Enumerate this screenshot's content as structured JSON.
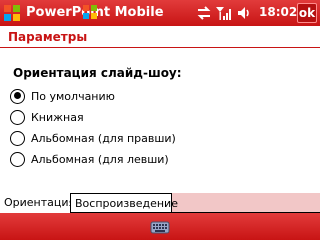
{
  "titlebar": {
    "app_title": "PowerPoint Mobile",
    "clock": "18:02",
    "ok_label": "ok",
    "icons": [
      "windows-start-icon",
      "connectivity-icon",
      "signal-icon",
      "speaker-icon"
    ]
  },
  "header": {
    "title": "Параметры"
  },
  "orientation": {
    "group_label": "Ориентация слайд-шоу:",
    "options": [
      {
        "label": "По умолчанию",
        "checked": true
      },
      {
        "label": "Книжная",
        "checked": false
      },
      {
        "label": "Альбомная (для правши)",
        "checked": false
      },
      {
        "label": "Альбомная (для левши)",
        "checked": false
      }
    ]
  },
  "tabs": [
    {
      "label": "Ориентация",
      "active": true
    },
    {
      "label": "Воспроизведение",
      "active": false
    }
  ],
  "bottombar": {
    "icon": "keyboard-icon"
  },
  "colors": {
    "accent": "#c81414",
    "tab_strip": "#f2c7c7"
  }
}
